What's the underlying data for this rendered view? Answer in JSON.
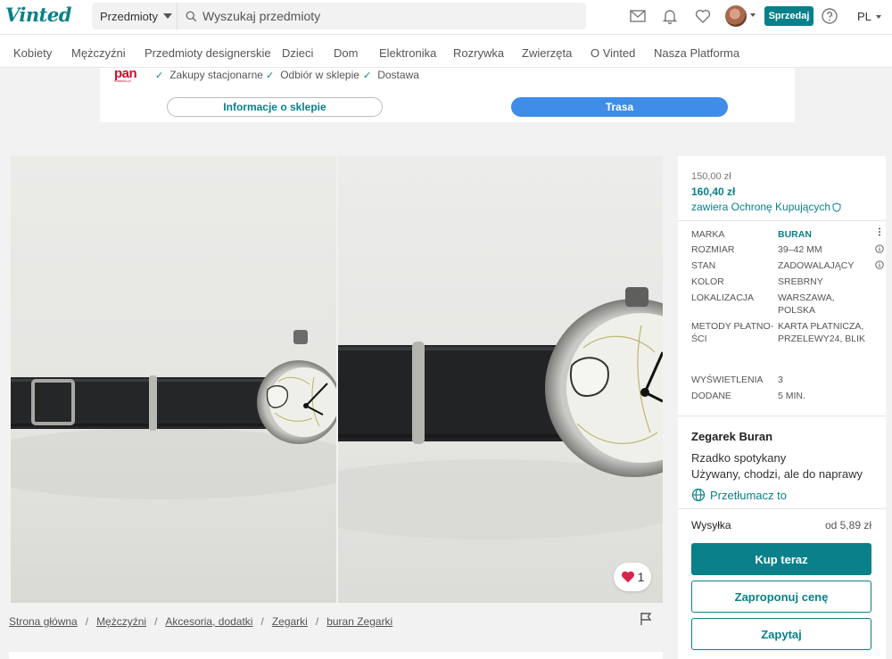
{
  "header": {
    "logo": "Vinted",
    "search_category": "Przedmioty",
    "search_placeholder": "Wyszukaj przedmioty",
    "sell_label": "Sprzedaj",
    "language": "PL"
  },
  "categories": [
    "Kobiety",
    "Mężczyźni",
    "Przedmioty designerskie",
    "Dzieci",
    "Dom",
    "Elektronika",
    "Rozrywka",
    "Zwierzęta",
    "O Vinted",
    "Nasza Platforma"
  ],
  "store": {
    "logo_text": "pan",
    "logo_sub": "materac.pl",
    "features": [
      "Zakupy stacjonarne",
      "Odbiór w sklepie",
      "Dostawa"
    ],
    "info_button": "Informacje o sklepie",
    "route_button": "Trasa"
  },
  "favorites_count": "1",
  "breadcrumb": [
    "Strona główna",
    "Mężczyźni",
    "Akcesoria, dodatki",
    "Zegarki",
    "buran Zegarki"
  ],
  "item": {
    "price": "150,00 zł",
    "price_total": "160,40 zł",
    "protection": "zawiera Ochronę Kupujących",
    "details": [
      {
        "key": "MARKA",
        "value": "BURAN"
      },
      {
        "key": "ROZMIAR",
        "value": "39–42 MM"
      },
      {
        "key": "STAN",
        "value": "ZADOWALAJĄCY"
      },
      {
        "key": "KOLOR",
        "value": "SREBRNY"
      },
      {
        "key": "LOKALIZACJA",
        "value": "WARSZAWA, POLSKA"
      },
      {
        "key": "METODY PŁATNO­ŚCI",
        "value": "KARTA PŁATNI­CZA, PRZELEWY24, BLIK"
      },
      {
        "key": "WYŚWIETLENIA",
        "value": "3"
      },
      {
        "key": "DODANE",
        "value": "5 MIN."
      }
    ],
    "title": "Zegarek Buran",
    "description_line1": "Rzadko spotykany",
    "description_line2": "Używany, chodzi, ale do naprawy",
    "translate": "Przetłumacz to",
    "shipping_label": "Wysyłka",
    "shipping_value": "od 5,89 zł",
    "buy_now": "Kup teraz",
    "make_offer": "Zaproponuj cenę",
    "ask": "Zapytaj"
  },
  "colors": {
    "brand": "#09808a",
    "route": "#3f8de9",
    "heart": "#d8254a"
  }
}
